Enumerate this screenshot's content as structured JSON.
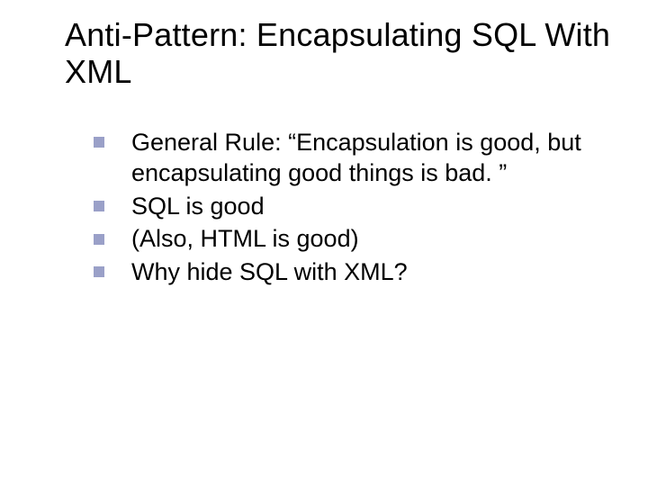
{
  "title": "Anti-Pattern: Encapsulating SQL With XML",
  "bullets": [
    "General Rule: “Encapsulation is good, but encapsulating good things is bad. ”",
    "SQL is good",
    "(Also, HTML is good)",
    "Why hide SQL with XML?"
  ]
}
